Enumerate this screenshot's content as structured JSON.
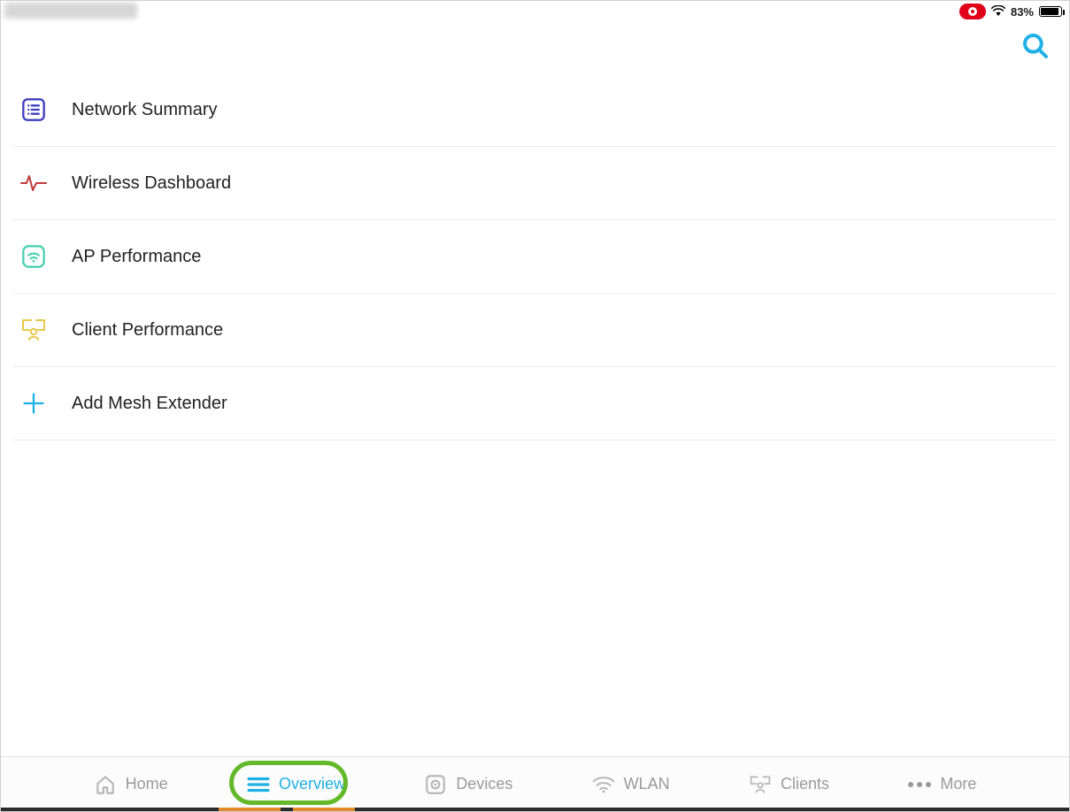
{
  "status": {
    "battery_text": "83%"
  },
  "menu": {
    "items": [
      {
        "label": "Network Summary"
      },
      {
        "label": "Wireless Dashboard"
      },
      {
        "label": "AP Performance"
      },
      {
        "label": "Client Performance"
      },
      {
        "label": "Add Mesh Extender"
      }
    ]
  },
  "nav": {
    "items": [
      {
        "label": "Home"
      },
      {
        "label": "Overview"
      },
      {
        "label": "Devices"
      },
      {
        "label": "WLAN"
      },
      {
        "label": "Clients"
      },
      {
        "label": "More"
      }
    ],
    "active_index": 1
  }
}
